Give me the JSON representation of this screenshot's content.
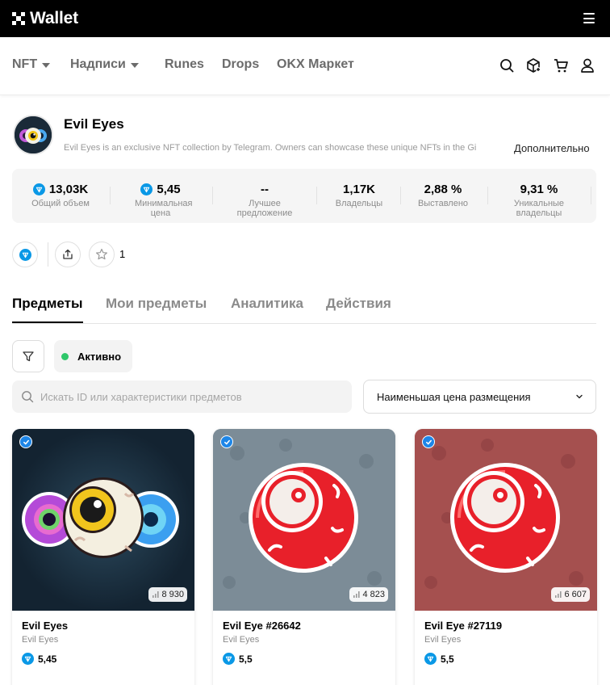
{
  "app": {
    "title": "Wallet"
  },
  "nav": {
    "items": [
      {
        "label": "NFT",
        "dropdown": true
      },
      {
        "label": "Надписи",
        "dropdown": true
      },
      {
        "label": "Runes",
        "dropdown": false
      },
      {
        "label": "Drops",
        "dropdown": false
      },
      {
        "label": "OKX Маркет",
        "dropdown": false
      }
    ],
    "icons": [
      "search-icon",
      "cube-icon",
      "cart-icon",
      "user-icon"
    ]
  },
  "collection": {
    "name": "Evil Eyes",
    "description": "Evil Eyes is an exclusive NFT collection by Telegram. Owners can showcase these unique NFTs in the Gi",
    "more_label": "Дополнительно"
  },
  "stats": [
    {
      "value": "13,03K",
      "label": "Общий объем",
      "ton": true
    },
    {
      "value": "5,45",
      "label": "Минимальная цена",
      "ton": true
    },
    {
      "value": "--",
      "label": "Лучшее предложение",
      "ton": false
    },
    {
      "value": "1,17K",
      "label": "Владельцы",
      "ton": false
    },
    {
      "value": "2,88 %",
      "label": "Выставлено",
      "ton": false
    },
    {
      "value": "9,31 %",
      "label": "Уникальные владельцы",
      "ton": false
    }
  ],
  "actions": {
    "favorite_count": "1"
  },
  "tabs": [
    {
      "label": "Предметы",
      "active": true
    },
    {
      "label": "Мои предметы",
      "active": false
    },
    {
      "label": "Аналитика",
      "active": false
    },
    {
      "label": "Действия",
      "active": false
    }
  ],
  "filters": {
    "status_chip": "Активно",
    "status_color": "#2fc76a"
  },
  "search": {
    "placeholder": "Искать ID или характеристики предметов",
    "value": ""
  },
  "sort": {
    "selected": "Наименьшая цена размещения"
  },
  "cards": [
    {
      "name": "Evil Eyes",
      "collection": "Evil Eyes",
      "price": "5,45",
      "count": "8 930",
      "bg": "#1f3443"
    },
    {
      "name": "Evil Eye #26642",
      "collection": "Evil Eyes",
      "price": "5,5",
      "count": "4 823",
      "bg": "#7b8b96"
    },
    {
      "name": "Evil Eye #27119",
      "collection": "Evil Eyes",
      "price": "5,5",
      "count": "6 607",
      "bg": "#a64e4f"
    }
  ],
  "colors": {
    "ton_blue": "#0a98e6",
    "verified_blue": "#1d86e8",
    "eye_red": "#e8202a"
  }
}
